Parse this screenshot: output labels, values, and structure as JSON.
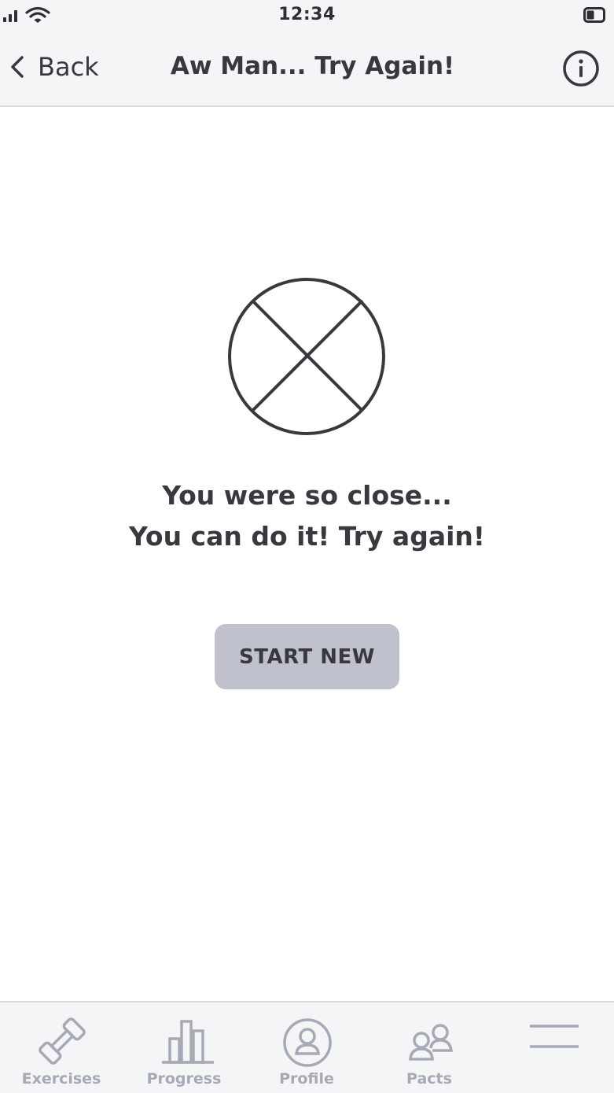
{
  "status_bar": {
    "time": "12:34"
  },
  "nav": {
    "back_label": "Back",
    "title": "Aw Man... Try Again!"
  },
  "main": {
    "message_line1": "You were so close...",
    "message_line2": "You can do it! Try again!",
    "start_button_label": "START NEW"
  },
  "tabs": [
    {
      "label": "Exercises",
      "icon": "dumbbell-icon"
    },
    {
      "label": "Progress",
      "icon": "bar-chart-icon"
    },
    {
      "label": "Profile",
      "icon": "user-circle-icon"
    },
    {
      "label": "Pacts",
      "icon": "group-icon"
    },
    {
      "label": "",
      "icon": "menu-icon"
    }
  ],
  "colors": {
    "text": "#3a383e",
    "bar_background": "#f4f5f7",
    "button": "#bfc2cd",
    "tab_inactive": "#a6aab6"
  }
}
